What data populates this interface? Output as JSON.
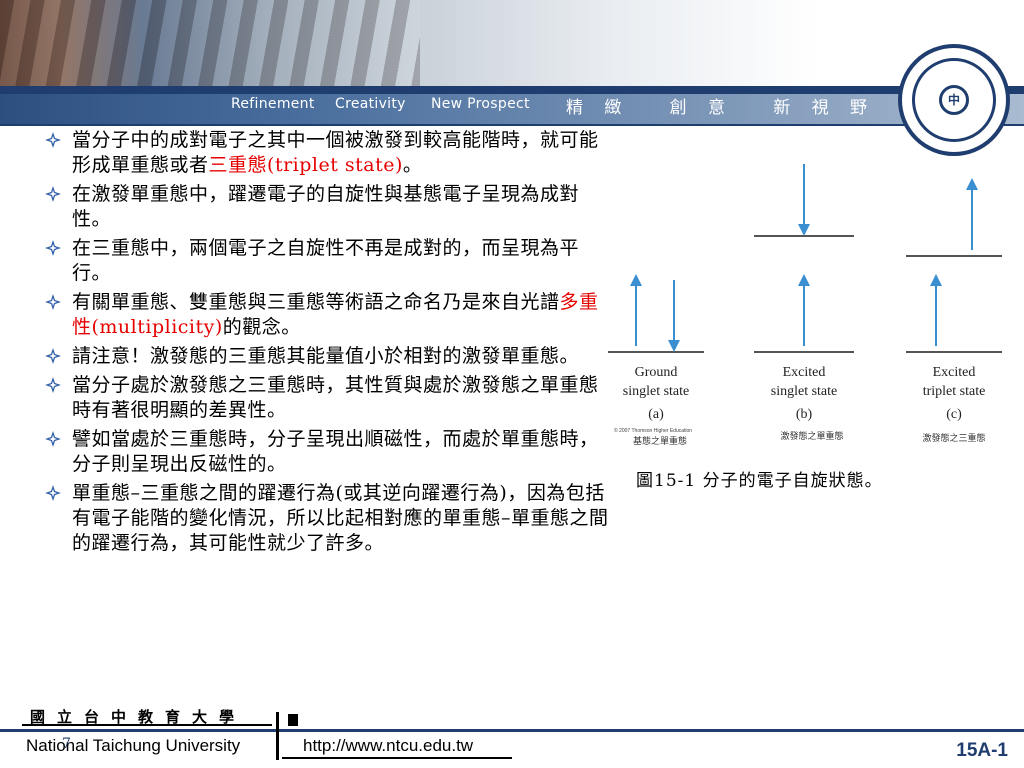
{
  "header": {
    "motto_en": [
      "Refinement",
      "Creativity",
      "New Prospect"
    ],
    "motto_zh": "精 緻   創 意   新 視 野",
    "emblem_char": "中"
  },
  "bullets": [
    {
      "segments": [
        {
          "text": "當分子中的成對電子之其中一個被激發到較高能階時，就可能形成單重態或者"
        },
        {
          "text": "三重態",
          "red": true
        },
        {
          "text": "(triplet state)",
          "red": true
        },
        {
          "text": "。"
        }
      ]
    },
    {
      "segments": [
        {
          "text": "在激發單重態中，躍遷電子的自旋性與基態電子呈現為成對性。"
        }
      ]
    },
    {
      "segments": [
        {
          "text": "在三重態中，兩個電子之自旋性不再是成對的，而呈現為平行。"
        }
      ]
    },
    {
      "segments": [
        {
          "text": "有關單重態、雙重態與三重態等術語之命名乃是來自光譜"
        },
        {
          "text": "多重性(multiplicity)",
          "red": true
        },
        {
          "text": "的觀念。"
        }
      ]
    },
    {
      "segments": [
        {
          "text": "請注意！激發態的三重態其能量值小於相對的激發單重態。"
        }
      ]
    },
    {
      "segments": [
        {
          "text": "當分子處於激發態之三重態時，其性質與處於激發態之單重態時有著很明顯的差異性。"
        }
      ]
    },
    {
      "segments": [
        {
          "text": "譬如當處於三重態時，分子呈現出順磁性，而處於單重態時，分子則呈現出反磁性的。"
        }
      ]
    },
    {
      "segments": [
        {
          "text": "單重態–三重態之間的躍遷行為(或其逆向躍遷行為)，因為包括有電子能階的變化情況，所以比起相對應的單重態–單重態之間的躍遷行為，其可能性就少了許多。"
        }
      ]
    }
  ],
  "figure": {
    "panels": [
      {
        "label1": "Ground",
        "label2": "singlet state",
        "letter": "(a)",
        "zh": "基態之單重態"
      },
      {
        "label1": "Excited",
        "label2": "singlet state",
        "letter": "(b)",
        "zh": "激發態之單重態"
      },
      {
        "label1": "Excited",
        "label2": "triplet state",
        "letter": "(c)",
        "zh": "激發態之三重態"
      }
    ],
    "copyright": "© 2007 Thomson Higher Education",
    "caption": "圖15-1  分子的電子自旋狀態。",
    "arrow_color": "#3a8fd1"
  },
  "footer": {
    "university_zh": "國立台中教育大學",
    "university_en": "National Taichung University",
    "url": "http://www.ntcu.edu.tw",
    "page": "15A-1",
    "mark": "7"
  },
  "colors": {
    "brand_blue": "#1f3d6e",
    "accent_red": "#e60000"
  }
}
